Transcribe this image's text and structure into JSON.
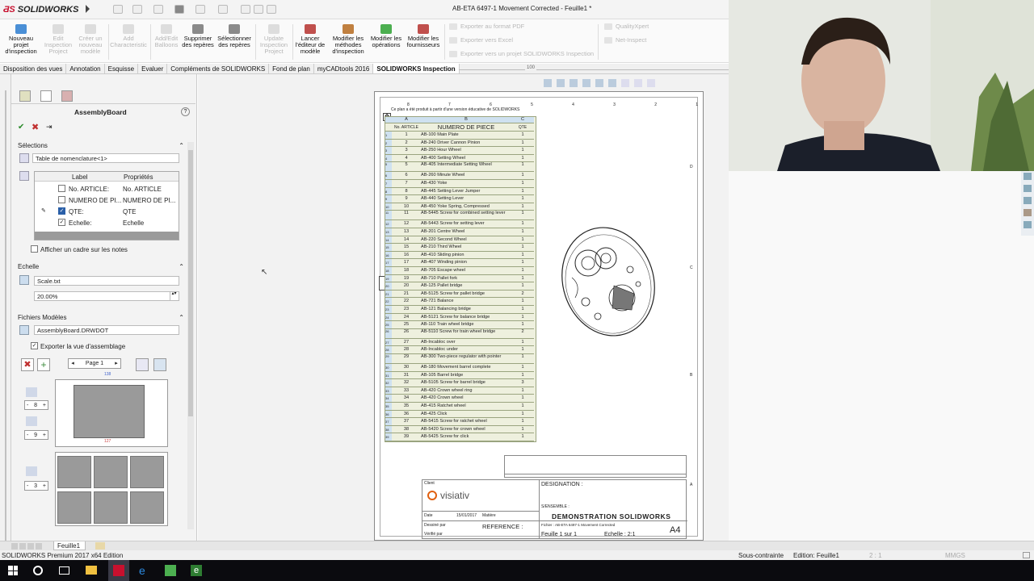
{
  "window": {
    "app_name": "SOLIDWORKS",
    "doc_title": "AB-ETA 6497-1 Movement Corrected - Feuille1 *"
  },
  "ribbon": {
    "buttons": [
      {
        "label": "Nouveau projet d'inspection",
        "enabled": true
      },
      {
        "label": "Edit Inspection Project",
        "enabled": false
      },
      {
        "label": "Créer un nouveau modèle",
        "enabled": false
      },
      {
        "label": "Add Characteristic",
        "enabled": false
      },
      {
        "label": "Add/Edit Balloons",
        "enabled": false
      },
      {
        "label": "Supprimer des repères",
        "enabled": true
      },
      {
        "label": "Sélectionner des repères",
        "enabled": true
      },
      {
        "label": "Update Inspection Project",
        "enabled": false
      },
      {
        "label": "Lancer l'éditeur de modèle",
        "enabled": true
      },
      {
        "label": "Modifier les méthodes d'inspection",
        "enabled": true
      },
      {
        "label": "Modifier les opérations",
        "enabled": true
      },
      {
        "label": "Modifier les fournisseurs",
        "enabled": true
      }
    ],
    "export": [
      "Exporter au format PDF",
      "Exporter vers Excel",
      "Exporter vers un projet SOLIDWORKS Inspection"
    ],
    "quality": [
      "QualityXpert",
      "Net-Inspect"
    ]
  },
  "tabs": [
    "Disposition des vues",
    "Annotation",
    "Esquisse",
    "Evaluer",
    "Compléments de SOLIDWORKS",
    "Fond de plan",
    "myCADtools 2016",
    "SOLIDWORKS Inspection"
  ],
  "active_tab": "SOLIDWORKS Inspection",
  "ruler_value": "100",
  "panel": {
    "title": "AssemblyBoard",
    "help": "?",
    "selections_label": "Sélections",
    "selection_value": "Table de nomenclature<1>",
    "columns": [
      "Label",
      "Propriétés"
    ],
    "rows": [
      {
        "checked": false,
        "label": "No. ARTICLE:",
        "prop": "No. ARTICLE"
      },
      {
        "checked": false,
        "label": "NUMERO DE PI...",
        "prop": "NUMERO DE PI..."
      },
      {
        "checked": true,
        "label": "QTE:",
        "prop": "QTE"
      },
      {
        "checked": true,
        "label": "Echelle:",
        "prop": "Echelle"
      }
    ],
    "frame_option": "Afficher un cadre sur les notes",
    "scale_label": "Echelle",
    "scale_file": "Scale.txt",
    "scale_value": "20.00%",
    "templates_label": "Fichiers Modèles",
    "template_file": "AssemblyBoard.DRWDOT",
    "export_option": "Exporter la vue d'assemblage",
    "page_label": "Page 1",
    "dim_width": "138",
    "dim_height": "127",
    "stepper1": "8",
    "stepper2": "9",
    "stepper3": "3"
  },
  "bom": {
    "header_note": "Ce plan a été produit à partir d'une version éducative de SOLIDWORKS",
    "col_letters": [
      "A",
      "B",
      "C"
    ],
    "headers": [
      "No. ARTICLE",
      "NUMERO DE PIECE",
      "QTE"
    ],
    "rows": [
      [
        "1",
        "AB-100 Main Plate",
        "1"
      ],
      [
        "2",
        "AB-240 Driver Cannon Pinion",
        "1"
      ],
      [
        "3",
        "AB-250 Hour Wheel",
        "1"
      ],
      [
        "4",
        "AB-400 Setting Wheel",
        "1"
      ],
      [
        "5",
        "AB-405 Intermediate Setting Wheel",
        "1"
      ],
      [
        "6",
        "AB-260 Minute Wheel",
        "1"
      ],
      [
        "7",
        "AB-430 Yoke",
        "1"
      ],
      [
        "8",
        "AB-445 Setting Lever Jumper",
        "1"
      ],
      [
        "9",
        "AB-440 Setting Lever",
        "1"
      ],
      [
        "10",
        "AB-450 Yoke Spring, Compressed",
        "1"
      ],
      [
        "11",
        "AB-5445 Screw for combined setting lever",
        "1"
      ],
      [
        "12",
        "AB-5443 Screw for setting lever",
        "1"
      ],
      [
        "13",
        "AB-201 Centre Wheel",
        "1"
      ],
      [
        "14",
        "AB-220 Second Wheel",
        "1"
      ],
      [
        "15",
        "AB-210 Third Wheel",
        "1"
      ],
      [
        "16",
        "AB-410 Sliding pinion",
        "1"
      ],
      [
        "17",
        "AB-407 Winding pinion",
        "1"
      ],
      [
        "18",
        "AB-705 Escape wheel",
        "1"
      ],
      [
        "19",
        "AB-710 Pallet fork",
        "1"
      ],
      [
        "20",
        "AB-125 Pallet bridge",
        "1"
      ],
      [
        "21",
        "AB-5125 Screw for pallet bridge",
        "2"
      ],
      [
        "22",
        "AB-721 Balance",
        "1"
      ],
      [
        "23",
        "AB-121 Balancing bridge",
        "1"
      ],
      [
        "24",
        "AB-5121 Screw for balance bridge",
        "1"
      ],
      [
        "25",
        "AB-110 Train wheel bridge",
        "1"
      ],
      [
        "26",
        "AB-5110 Screw for train wheel bridge",
        "2"
      ],
      [
        "27",
        "AB-Incabloc over",
        "1"
      ],
      [
        "28",
        "AB-Incabloc under",
        "1"
      ],
      [
        "29",
        "AB-300 Two-piece regulator with pointer",
        "1"
      ],
      [
        "30",
        "AB-180 Movement barrel complete",
        "1"
      ],
      [
        "31",
        "AB-105 Barrel bridge",
        "1"
      ],
      [
        "32",
        "AB-5105 Screw for barrel bridge",
        "3"
      ],
      [
        "33",
        "AB-420 Crown wheel ring",
        "1"
      ],
      [
        "34",
        "AB-420 Crown wheel",
        "1"
      ],
      [
        "35",
        "AB-415 Ratchet wheel",
        "1"
      ],
      [
        "36",
        "AB-425 Click",
        "1"
      ],
      [
        "37",
        "AB-5415 Screw for ratchet wheel",
        "1"
      ],
      [
        "38",
        "AB-5420 Screw for crown wheel",
        "1"
      ],
      [
        "39",
        "AB-5425 Screw for click",
        "1"
      ]
    ]
  },
  "sheet_border": {
    "top": [
      "8",
      "7",
      "6",
      "5",
      "4",
      "3",
      "2",
      "1"
    ],
    "right": [
      "D",
      "C",
      "B",
      "A"
    ]
  },
  "title_block": {
    "client_label": "Client",
    "designation_label": "DESIGNATION :",
    "sous_ensemble": "S/ENSEMBLE :",
    "title": "DEMONSTRATION SOLIDWORKS",
    "date_label": "Date",
    "date_value": "15/01/2017",
    "matiere_label": "Matière",
    "dessine_label": "Dessiné par",
    "reference_label": "REFERENCE :",
    "verifie_label": "Vérifié par",
    "fichier": "Fichier : AB-ETA 6497-1 Movement Corrected",
    "feuille": "Feuille 1 sur 1",
    "echelle": "Echelle : 2:1",
    "format": "A4",
    "brand": "visiativ"
  },
  "sheet_tabs": [
    "Feuille1"
  ],
  "status": {
    "left": "SOLIDWORKS Premium 2017 x64 Edition",
    "constraint": "Sous-contrainte",
    "edition": "Edition: Feuille1",
    "scale": "2 : 1",
    "units": "MMGS"
  },
  "colors": {
    "solidworks_red": "#c8102e",
    "bom_fill": "#eef0de",
    "taskbar": "#0b0b0f",
    "active_tab": "#ffffff"
  }
}
